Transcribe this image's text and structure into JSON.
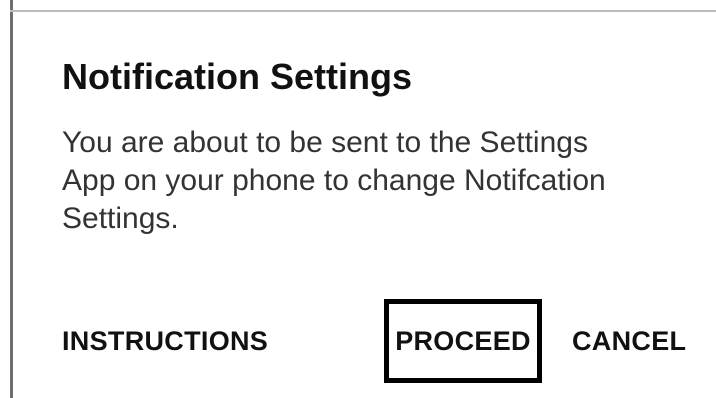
{
  "dialog": {
    "title": "Notification Settings",
    "message_lines": [
      "You are about to be sent to the Settings",
      "App on your phone to change Notifcation",
      "Settings."
    ]
  },
  "actions": {
    "instructions_label": "INSTRUCTIONS",
    "proceed_label": "PROCEED",
    "cancel_label": "CANCEL"
  }
}
